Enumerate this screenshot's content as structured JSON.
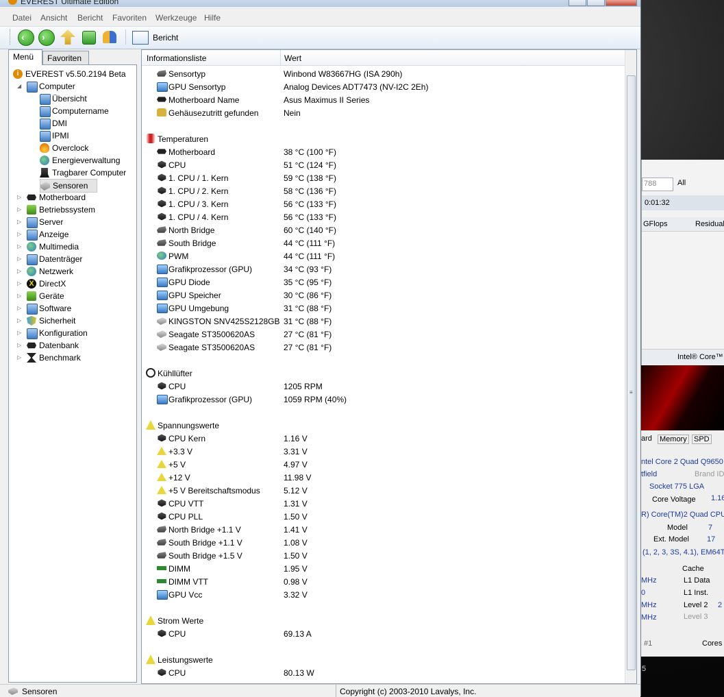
{
  "window": {
    "title": "EVEREST Ultimate Edition"
  },
  "menubar": [
    "Datei",
    "Ansicht",
    "Bericht",
    "Favoriten",
    "Werkzeuge",
    "Hilfe"
  ],
  "toolbar": {
    "report_label": "Bericht"
  },
  "left_tabs": [
    "Menü",
    "Favoriten"
  ],
  "tree": [
    {
      "label": "EVEREST v5.50.2194 Beta",
      "icon": "info-icon",
      "level": 0
    },
    {
      "label": "Computer",
      "icon": "computer-icon",
      "level": 1,
      "expanded": true
    },
    {
      "label": "Übersicht",
      "icon": "computer-icon",
      "level": 2
    },
    {
      "label": "Computername",
      "icon": "computer-icon",
      "level": 2
    },
    {
      "label": "DMI",
      "icon": "computer-icon",
      "level": 2
    },
    {
      "label": "IPMI",
      "icon": "computer-icon",
      "level": 2
    },
    {
      "label": "Overclock",
      "icon": "fire-icon",
      "level": 2
    },
    {
      "label": "Energieverwaltung",
      "icon": "power-icon",
      "level": 2
    },
    {
      "label": "Tragbarer Computer",
      "icon": "laptop-icon",
      "level": 2
    },
    {
      "label": "Sensoren",
      "icon": "sensor-icon",
      "level": 2,
      "selected": true
    },
    {
      "label": "Motherboard",
      "icon": "motherboard-icon",
      "level": 1
    },
    {
      "label": "Betriebssystem",
      "icon": "windows-icon",
      "level": 1
    },
    {
      "label": "Server",
      "icon": "server-icon",
      "level": 1
    },
    {
      "label": "Anzeige",
      "icon": "display-icon",
      "level": 1
    },
    {
      "label": "Multimedia",
      "icon": "multimedia-icon",
      "level": 1
    },
    {
      "label": "Datenträger",
      "icon": "drive-icon",
      "level": 1
    },
    {
      "label": "Netzwerk",
      "icon": "globe-icon",
      "level": 1
    },
    {
      "label": "DirectX",
      "icon": "directx-icon",
      "level": 1
    },
    {
      "label": "Geräte",
      "icon": "devices-icon",
      "level": 1
    },
    {
      "label": "Software",
      "icon": "software-icon",
      "level": 1
    },
    {
      "label": "Sicherheit",
      "icon": "shield-icon",
      "level": 1
    },
    {
      "label": "Konfiguration",
      "icon": "config-icon",
      "level": 1
    },
    {
      "label": "Datenbank",
      "icon": "database-icon",
      "level": 1
    },
    {
      "label": "Benchmark",
      "icon": "hourglass-icon",
      "level": 1
    }
  ],
  "list": {
    "col_name": "Informationsliste",
    "col_value": "Wert",
    "rows": [
      {
        "type": "item",
        "label": "Sensortyp",
        "value": "Winbond W83667HG  (ISA 290h)",
        "icon": "chip-grey"
      },
      {
        "type": "item",
        "label": "GPU Sensortyp",
        "value": "Analog Devices ADT7473  (NV-I2C 2Eh)",
        "icon": "gpu"
      },
      {
        "type": "item",
        "label": "Motherboard Name",
        "value": "Asus Maximus II Series",
        "icon": "chip"
      },
      {
        "type": "item",
        "label": "Gehäusezutritt gefunden",
        "value": "Nein",
        "icon": "lock"
      },
      {
        "type": "gap"
      },
      {
        "type": "section",
        "label": "Temperaturen",
        "icon": "therm"
      },
      {
        "type": "item",
        "label": "Motherboard",
        "value": "38 °C  (100 °F)",
        "icon": "chip"
      },
      {
        "type": "item",
        "label": "CPU",
        "value": "51 °C  (124 °F)",
        "icon": "cpu"
      },
      {
        "type": "item",
        "label": "1. CPU / 1. Kern",
        "value": "59 °C  (138 °F)",
        "icon": "cpu"
      },
      {
        "type": "item",
        "label": "1. CPU / 2. Kern",
        "value": "58 °C  (136 °F)",
        "icon": "cpu"
      },
      {
        "type": "item",
        "label": "1. CPU / 3. Kern",
        "value": "56 °C  (133 °F)",
        "icon": "cpu"
      },
      {
        "type": "item",
        "label": "1. CPU / 4. Kern",
        "value": "56 °C  (133 °F)",
        "icon": "cpu"
      },
      {
        "type": "item",
        "label": "North Bridge",
        "value": "60 °C  (140 °F)",
        "icon": "chip-grey"
      },
      {
        "type": "item",
        "label": "South Bridge",
        "value": "44 °C  (111 °F)",
        "icon": "chip-grey"
      },
      {
        "type": "item",
        "label": "PWM",
        "value": "44 °C  (111 °F)",
        "icon": "pwm"
      },
      {
        "type": "item",
        "label": "Grafikprozessor (GPU)",
        "value": "34 °C  (93 °F)",
        "icon": "gpu"
      },
      {
        "type": "item",
        "label": "GPU Diode",
        "value": "35 °C  (95 °F)",
        "icon": "gpu"
      },
      {
        "type": "item",
        "label": "GPU Speicher",
        "value": "30 °C  (86 °F)",
        "icon": "gpu"
      },
      {
        "type": "item",
        "label": "GPU Umgebung",
        "value": "31 °C  (88 °F)",
        "icon": "gpu"
      },
      {
        "type": "item",
        "label": "KINGSTON SNV425S2128GB",
        "value": "31 °C  (88 °F)",
        "icon": "hdd"
      },
      {
        "type": "item",
        "label": "Seagate ST3500620AS",
        "value": "27 °C  (81 °F)",
        "icon": "hdd"
      },
      {
        "type": "item",
        "label": "Seagate ST3500620AS",
        "value": "27 °C  (81 °F)",
        "icon": "hdd"
      },
      {
        "type": "gap"
      },
      {
        "type": "section",
        "label": "Kühllüfter",
        "icon": "fan"
      },
      {
        "type": "item",
        "label": "CPU",
        "value": "1205 RPM",
        "icon": "cpu"
      },
      {
        "type": "item",
        "label": "Grafikprozessor (GPU)",
        "value": "1059 RPM  (40%)",
        "icon": "gpu"
      },
      {
        "type": "gap"
      },
      {
        "type": "section",
        "label": "Spannungswerte",
        "icon": "warn"
      },
      {
        "type": "item",
        "label": "CPU Kern",
        "value": "1.16 V",
        "icon": "cpu"
      },
      {
        "type": "item",
        "label": "+3.3 V",
        "value": "3.31 V",
        "icon": "warn"
      },
      {
        "type": "item",
        "label": "+5 V",
        "value": "4.97 V",
        "icon": "warn"
      },
      {
        "type": "item",
        "label": "+12 V",
        "value": "11.98 V",
        "icon": "warn"
      },
      {
        "type": "item",
        "label": "+5 V Bereitschaftsmodus",
        "value": "5.12 V",
        "icon": "warn"
      },
      {
        "type": "item",
        "label": "CPU VTT",
        "value": "1.31 V",
        "icon": "cpu"
      },
      {
        "type": "item",
        "label": "CPU PLL",
        "value": "1.50 V",
        "icon": "cpu"
      },
      {
        "type": "item",
        "label": "North Bridge +1.1 V",
        "value": "1.41 V",
        "icon": "chip-grey"
      },
      {
        "type": "item",
        "label": "South Bridge +1.1 V",
        "value": "1.08 V",
        "icon": "chip-grey"
      },
      {
        "type": "item",
        "label": "South Bridge +1.5 V",
        "value": "1.50 V",
        "icon": "chip-grey"
      },
      {
        "type": "item",
        "label": "DIMM",
        "value": "1.95 V",
        "icon": "dimm"
      },
      {
        "type": "item",
        "label": "DIMM VTT",
        "value": "0.98 V",
        "icon": "dimm"
      },
      {
        "type": "item",
        "label": "GPU Vcc",
        "value": "3.32 V",
        "icon": "gpu"
      },
      {
        "type": "gap"
      },
      {
        "type": "section",
        "label": "Strom Werte",
        "icon": "warn"
      },
      {
        "type": "item",
        "label": "CPU",
        "value": "69.13 A",
        "icon": "cpu"
      },
      {
        "type": "gap"
      },
      {
        "type": "section",
        "label": "Leistungswerte",
        "icon": "warn"
      },
      {
        "type": "item",
        "label": "CPU",
        "value": "80.13 W",
        "icon": "cpu"
      }
    ]
  },
  "statusbar": {
    "left": "Sensoren",
    "right": "Copyright (c) 2003-2010 Lavalys, Inc."
  },
  "background": {
    "texts": [
      "788",
      "All",
      "0:01:32",
      "GFlops",
      "Residual",
      "Intel® Core™",
      "ard",
      "Memory",
      "SPD",
      "ntel Core 2 Quad Q9650",
      "tfield",
      "Brand ID",
      "Socket 775 LGA",
      "Core Voltage",
      "1.16",
      "R) Core(TM)2 Quad CPU",
      "Model",
      "7",
      "Ext. Model",
      "17",
      "(1, 2, 3, 3S, 4.1), EM64T,",
      "Cache",
      "MHz",
      "L1 Data",
      "0",
      "L1 Inst.",
      "MHz",
      "Level 2",
      "2",
      "MHz",
      "Level 3",
      "#1",
      "Cores",
      "5"
    ]
  }
}
